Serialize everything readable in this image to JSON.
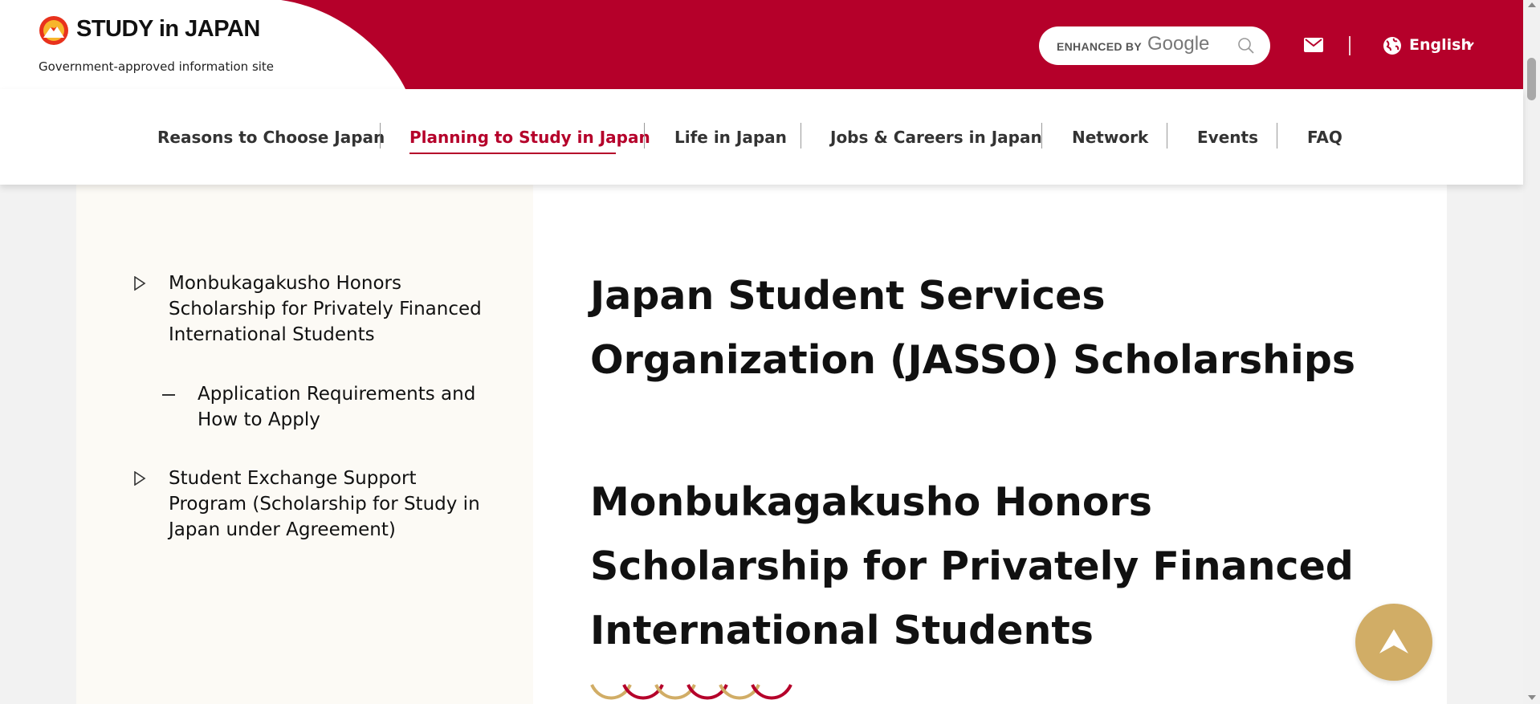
{
  "header": {
    "logo_title": "STUDY in JAPAN",
    "logo_subtitle": "Government-approved information site",
    "search": {
      "enhanced_label": "ENHANCED BY",
      "provider": "Google"
    },
    "language": "English"
  },
  "nav": {
    "items": [
      {
        "label": "Reasons to Choose Japan"
      },
      {
        "label": "Planning to Study in Japan"
      },
      {
        "label": "Life in Japan"
      },
      {
        "label": "Jobs & Careers in Japan"
      },
      {
        "label": "Network"
      },
      {
        "label": "Events"
      },
      {
        "label": "FAQ"
      }
    ],
    "active_index": 1
  },
  "sidebar": {
    "items": [
      {
        "label": "Monbukagakusho Honors Scholarship for Privately Financed International Students"
      },
      {
        "label": "Application Requirements and How to Apply"
      },
      {
        "label": "Student Exchange Support Program (Scholarship for Study in Japan under Agreement)"
      }
    ]
  },
  "main": {
    "headings": [
      "Japan Student Services Organization (JASSO) Scholarships",
      "Monbukagakusho Honors Scholarship for Privately Financed International Students"
    ]
  },
  "colors": {
    "brand_red": "#b5002a",
    "gold": "#d1ad66",
    "sidebar_bg": "#fcfaf5"
  },
  "icons": [
    "search-icon",
    "mail-icon",
    "globe-icon",
    "chevron-down-icon",
    "chevron-right-icon",
    "arrow-up-icon"
  ]
}
